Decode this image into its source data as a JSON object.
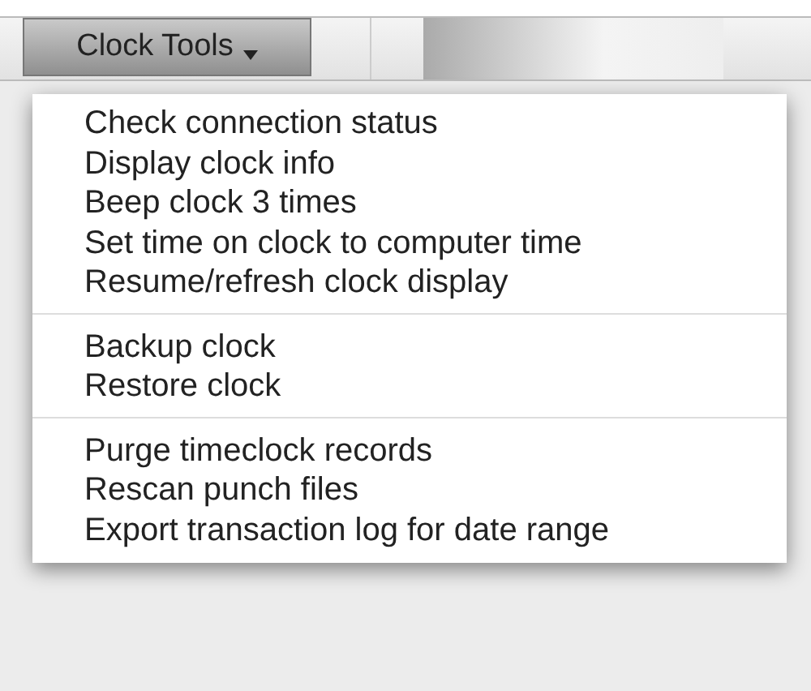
{
  "toolbar": {
    "menu_button": {
      "label": "Clock Tools",
      "expanded": true
    }
  },
  "menu": {
    "groups": [
      {
        "items": [
          "Check connection status",
          "Display clock info",
          "Beep clock 3 times",
          "Set time on clock to computer time",
          "Resume/refresh clock display"
        ]
      },
      {
        "items": [
          "Backup clock",
          "Restore clock"
        ]
      },
      {
        "items": [
          "Purge timeclock records",
          "Rescan punch files",
          "Export transaction log for date range"
        ]
      }
    ]
  }
}
